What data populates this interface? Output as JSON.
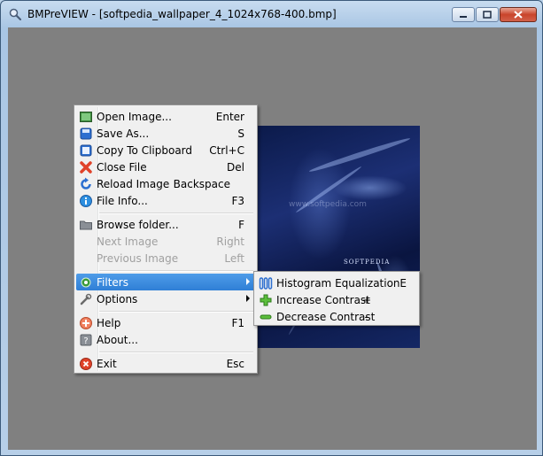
{
  "window": {
    "title": "BMPreVIEW - [softpedia_wallpaper_4_1024x768-400.bmp]",
    "app_icon": "magnifier-icon",
    "buttons": [
      "minimize-icon",
      "maximize-icon",
      "close-icon"
    ]
  },
  "image": {
    "watermark": "SOFTPEDIA",
    "faint_text": "www.softpedia.com"
  },
  "menu": {
    "items": [
      {
        "label": "Open Image...",
        "shortcut": "Enter",
        "icon": "image-icon"
      },
      {
        "label": "Save As...",
        "shortcut": "S",
        "icon": "save-icon"
      },
      {
        "label": "Copy To Clipboard",
        "shortcut": "Ctrl+C",
        "icon": "clipboard-icon"
      },
      {
        "label": "Close File",
        "shortcut": "Del",
        "icon": "close-file-icon"
      },
      {
        "label": "Reload Image",
        "shortcut": "Backspace",
        "icon": "reload-icon"
      },
      {
        "label": "File Info...",
        "shortcut": "F3",
        "icon": "info-icon"
      },
      {
        "label": "Browse folder...",
        "shortcut": "F",
        "icon": "folder-icon"
      },
      {
        "label": "Next Image",
        "shortcut": "Right",
        "disabled": true
      },
      {
        "label": "Previous Image",
        "shortcut": "Left",
        "disabled": true
      },
      {
        "label": "Filters",
        "icon": "filters-icon",
        "highlighted": true,
        "submenu": true
      },
      {
        "label": "Options",
        "icon": "options-icon",
        "submenu": true
      },
      {
        "label": "Help",
        "shortcut": "F1",
        "icon": "help-icon"
      },
      {
        "label": "About...",
        "icon": "about-icon"
      },
      {
        "label": "Exit",
        "shortcut": "Esc",
        "icon": "exit-icon"
      }
    ]
  },
  "submenu": {
    "items": [
      {
        "label": "Histogram Equalization",
        "shortcut": "E",
        "icon": "histogram-icon"
      },
      {
        "label": "Increase Contrast",
        "shortcut": "+",
        "icon": "plus-icon"
      },
      {
        "label": "Decrease Contrast",
        "shortcut": "-",
        "icon": "minus-icon"
      }
    ]
  },
  "colors": {
    "highlight": "#3288dc",
    "background": "#808080"
  }
}
